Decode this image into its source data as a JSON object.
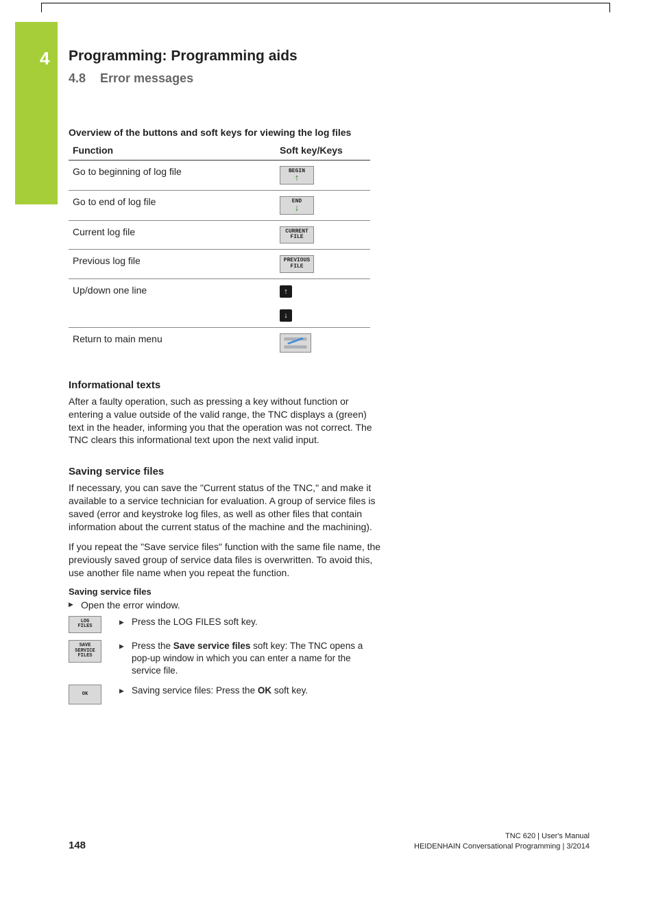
{
  "chapter": {
    "number": "4",
    "title": "Programming: Programming aids"
  },
  "section": {
    "number": "4.8",
    "title": "Error messages"
  },
  "table": {
    "caption": "Overview of the buttons and soft keys for viewing the log files",
    "headers": {
      "func": "Function",
      "key": "Soft key/Keys"
    },
    "rows": [
      {
        "func": "Go to beginning of log file",
        "key_label": "BEGIN"
      },
      {
        "func": "Go to end of log file",
        "key_label": "END"
      },
      {
        "func": "Current log file",
        "key_label": "CURRENT FILE"
      },
      {
        "func": "Previous log file",
        "key_label": "PREVIOUS FILE"
      },
      {
        "func": "Up/down one line",
        "key_label": "arrows"
      },
      {
        "func": "Return to main menu",
        "key_label": "return"
      }
    ]
  },
  "info": {
    "heading": "Informational texts",
    "para": "After a faulty operation, such as pressing a key without function or entering a value outside of the valid range, the TNC displays a (green) text in the header, informing you that the operation was not correct. The TNC clears this informational text upon the next valid input."
  },
  "saving": {
    "heading": "Saving service files",
    "para1": "If necessary, you can save the \"Current status of the TNC,\" and make it available to a service technician for evaluation. A group of service files is saved (error and keystroke log files, as well as other files that contain information about the current status of the machine and the machining).",
    "para2": "If you repeat the \"Save service files\" function with the same file name, the previously saved group of service data files is overwritten. To avoid this, use another file name when you repeat the function.",
    "sub": "Saving service files",
    "open_step": "Open the error window.",
    "steps": [
      {
        "key": "LOG FILES",
        "text_prefix": "Press the ",
        "text_bold": "",
        "text_plain": "LOG FILES soft key."
      },
      {
        "key": "SAVE SERVICE FILES",
        "text_prefix": "Press the ",
        "text_bold": "Save service files",
        "text_suffix": " soft key: The TNC opens a pop-up window in which you can enter a name for the service file."
      },
      {
        "key": "OK",
        "text_prefix": "Saving service files: Press the ",
        "text_bold": "OK",
        "text_suffix": " soft key."
      }
    ]
  },
  "footer": {
    "page": "148",
    "line1": "TNC 620 | User's Manual",
    "line2": "HEIDENHAIN Conversational Programming | 3/2014"
  }
}
